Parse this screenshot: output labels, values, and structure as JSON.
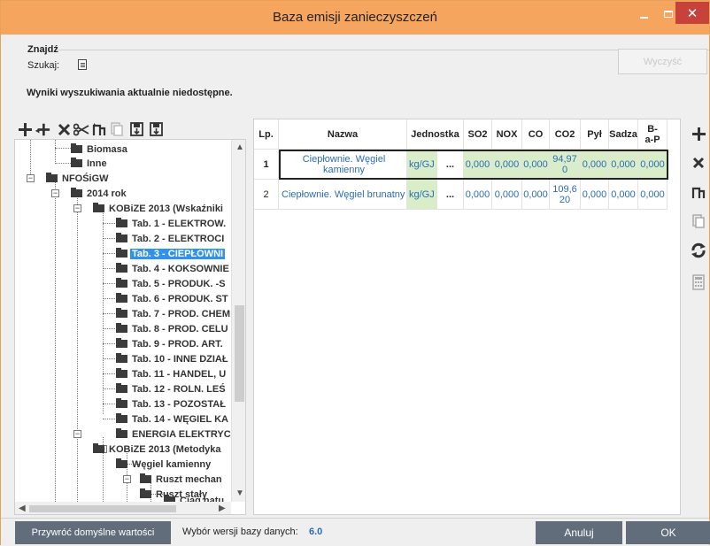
{
  "window": {
    "title": "Baza emisji zanieczyszczeń"
  },
  "search": {
    "group_label": "Znajdź",
    "search_label": "Szukaj:",
    "clear_label": "Wyczyść",
    "results_message": "Wyniki wyszukiwania aktualnie niedostępne."
  },
  "tree": {
    "items": [
      {
        "label": "Biomasa",
        "selected": false
      },
      {
        "label": "Inne",
        "selected": false
      },
      {
        "label": "NFOŚiGW",
        "selected": false
      },
      {
        "label": "2014 rok",
        "selected": false
      },
      {
        "label": "KOBiZE 2013 (Wskaźniki",
        "selected": false
      },
      {
        "label": "Tab. 1 - ELEKTROW.",
        "selected": false
      },
      {
        "label": "Tab. 2 - ELEKTROCI",
        "selected": false
      },
      {
        "label": "Tab. 3 - CIEPŁOWNI",
        "selected": true
      },
      {
        "label": "Tab. 4 - KOKSOWNIE",
        "selected": false
      },
      {
        "label": "Tab. 5 - PRODUK. -S",
        "selected": false
      },
      {
        "label": "Tab. 6 - PRODUK. ST",
        "selected": false
      },
      {
        "label": "Tab. 7 - PROD. CHEM",
        "selected": false
      },
      {
        "label": "Tab. 8 - PROD. CELU",
        "selected": false
      },
      {
        "label": "Tab. 9 - PROD. ART.",
        "selected": false
      },
      {
        "label": "Tab. 10 - INNE DZIAŁ",
        "selected": false
      },
      {
        "label": "Tab. 11 - HANDEL, U",
        "selected": false
      },
      {
        "label": "Tab. 12 - ROLN. LEŚ",
        "selected": false
      },
      {
        "label": "Tab. 13 - POZOSTAŁ",
        "selected": false
      },
      {
        "label": "Tab. 14 - WĘGIEL KA",
        "selected": false
      },
      {
        "label": "ENERGIA ELEKTRYC",
        "selected": false
      },
      {
        "label": "KOBiZE 2013 (Metodyka",
        "selected": false
      },
      {
        "label": "Węgiel kamienny",
        "selected": false
      },
      {
        "label": "Ruszt mechan",
        "selected": false
      },
      {
        "label": "Ruszt stały",
        "selected": false
      },
      {
        "label": "Ciąg natu",
        "selected": false
      }
    ]
  },
  "table": {
    "headers": [
      "Lp.",
      "Nazwa",
      "Jednostka",
      "SO2",
      "NOX",
      "CO",
      "CO2",
      "Pył",
      "Sadza",
      "B-a-P"
    ],
    "rows": [
      {
        "lp": "1",
        "nazwa": "Ciepłownie. Węgiel kamienny",
        "jednostka": "kg/GJ",
        "more": "...",
        "so2": "0,000",
        "nox": "0,000",
        "co": "0,000",
        "co2": "94,970",
        "pyl": "0,000",
        "sadza": "0,000",
        "bap": "0,000"
      },
      {
        "lp": "2",
        "nazwa": "Ciepłownie. Węgiel brunatny",
        "jednostka": "kg/GJ",
        "more": "...",
        "so2": "0,000",
        "nox": "0,000",
        "co": "0,000",
        "co2": "109,620",
        "pyl": "0,000",
        "sadza": "0,000",
        "bap": "0,000"
      }
    ]
  },
  "footer": {
    "restore_label": "Przywróć domyślne wartości",
    "version_label": "Wybór wersji bazy danych:",
    "version_value": "6.0",
    "cancel_label": "Anuluj",
    "ok_label": "OK"
  },
  "icons": {
    "toolbar": [
      "plus-icon",
      "add-child-icon",
      "delete-icon",
      "cut-icon",
      "move-icon",
      "copy-icon",
      "save-icon",
      "save-as-icon"
    ],
    "right_toolbar": [
      "plus-icon",
      "delete-icon",
      "move-icon",
      "copy-icon",
      "refresh-icon",
      "calculator-icon"
    ]
  },
  "colors": {
    "titlebar": "#f6a55e",
    "close": "#c7423a",
    "selection": "#2f93e7",
    "button": "#616d7b",
    "unit_cell": "#d9eec8",
    "value_text": "#2b6cb5"
  }
}
